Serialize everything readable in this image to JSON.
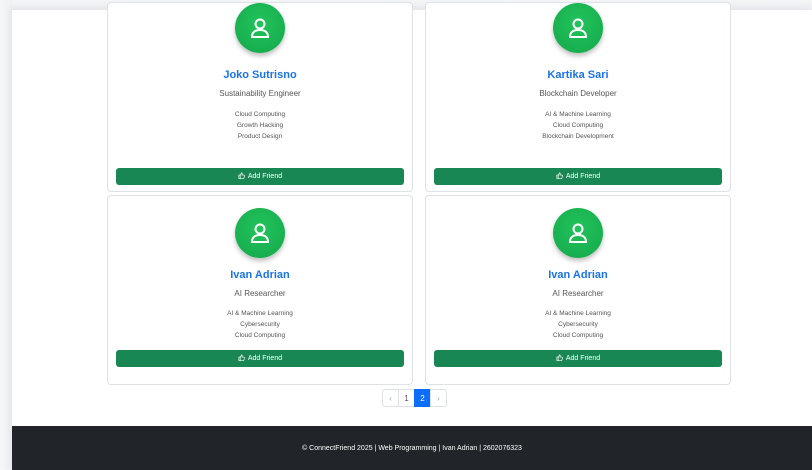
{
  "colors": {
    "avatar_green": "#1db954",
    "name_blue": "#1a73e8",
    "button_green": "#198754",
    "pagination_active": "#0d6efd",
    "footer_bg": "#212529"
  },
  "cards": [
    {
      "name": "Joko Sutrisno",
      "role": "Sustainability Engineer",
      "skills": [
        "Cloud Computing",
        "Growth Hacking",
        "Product Design"
      ],
      "button_label": "Add Friend",
      "avatar_icon": "user-icon",
      "button_icon": "thumbs-up-icon"
    },
    {
      "name": "Kartika Sari",
      "role": "Blockchain Developer",
      "skills": [
        "AI & Machine Learning",
        "Cloud Computing",
        "Blockchain Development"
      ],
      "button_label": "Add Friend",
      "avatar_icon": "user-icon",
      "button_icon": "thumbs-up-icon"
    },
    {
      "name": "Ivan Adrian",
      "role": "AI Researcher",
      "skills": [
        "AI & Machine Learning",
        "Cybersecurity",
        "Cloud Computing"
      ],
      "button_label": "Add Friend",
      "avatar_icon": "user-icon",
      "button_icon": "thumbs-up-icon"
    },
    {
      "name": "Ivan Adrian",
      "role": "AI Researcher",
      "skills": [
        "AI & Machine Learning",
        "Cybersecurity",
        "Cloud Computing"
      ],
      "button_label": "Add Friend",
      "avatar_icon": "user-icon",
      "button_icon": "thumbs-up-icon"
    }
  ],
  "pagination": {
    "prev": "‹",
    "pages": [
      "1",
      "2"
    ],
    "active_page": "2",
    "next": "›"
  },
  "footer": {
    "text": "© ConnectFriend 2025 | Web Programming | Ivan Adrian | 2602076323"
  }
}
